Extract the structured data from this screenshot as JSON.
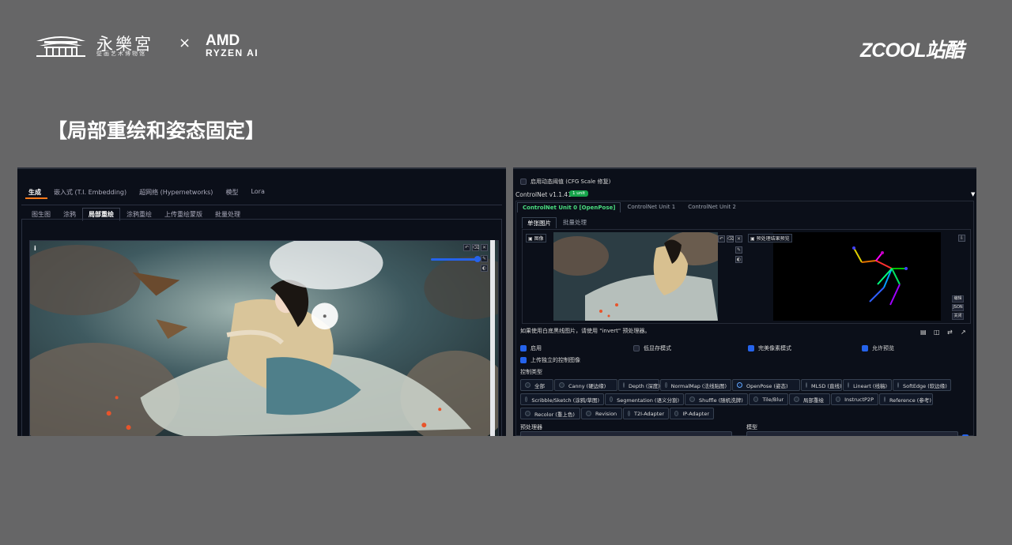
{
  "header": {
    "brand_cn": "永樂宮",
    "brand_sub": "壁画艺术博物馆",
    "times": "×",
    "amd": "AMD",
    "ryzen": "RYZEN AI",
    "zcool": "ZCOOL站酷"
  },
  "title": "【局部重绘和姿态固定】",
  "left": {
    "main_tabs": [
      "生成",
      "嵌入式 (T.I. Embedding)",
      "超网络 (Hypernetworks)",
      "模型",
      "Lora"
    ],
    "sub_tabs": [
      "图生图",
      "涂鸦",
      "局部重绘",
      "涂鸦重绘",
      "上传重绘蒙版",
      "批量处理"
    ],
    "active_sub_tab": "局部重绘",
    "info_icon": "i",
    "tool_icons": [
      "undo-icon",
      "clear-icon",
      "close-icon"
    ],
    "brush_icon": "brush-icon",
    "palette_icon": "palette-icon",
    "brush_size_fraction": 0.95
  },
  "right": {
    "cfg_label": "启用动态阈值 (CFG Scale 修复)",
    "controlnet_version": "ControlNet v1.1.410",
    "unit_badge": "1 unit",
    "unit_tabs": [
      "ControlNet Unit 0 [OpenPose]",
      "ControlNet Unit 1",
      "ControlNet Unit 2"
    ],
    "image_tabs": [
      "单张图片",
      "批量处理"
    ],
    "image_label": "图像",
    "preview_label": "预处理结果预览",
    "side_buttons": [
      "编辑",
      "JSON",
      "关闭"
    ],
    "invert_hint": "如果使用白底黑线图片，请使用 \"invert\" 预处理器。",
    "checkboxes": [
      {
        "label": "启用",
        "checked": true
      },
      {
        "label": "低显存模式",
        "checked": false
      },
      {
        "label": "完美像素模式",
        "checked": true
      },
      {
        "label": "允许预览",
        "checked": true
      }
    ],
    "upload_independent": {
      "label": "上传独立的控制图像",
      "checked": true
    },
    "control_type_label": "控制类型",
    "control_types_row1": [
      "全部",
      "Canny (硬边缘)",
      "Depth (深度)",
      "NormalMap (法线贴图)",
      "OpenPose (姿态)",
      "MLSD (直线)",
      "Lineart (线稿)",
      "SoftEdge (软边缘)"
    ],
    "control_types_row2": [
      "Scribble/Sketch (涂鸦/草图)",
      "Segmentation (语义分割)",
      "Shuffle (随机洗牌)",
      "Tile/Blur",
      "局部重绘",
      "InstructP2P",
      "Reference (参考)"
    ],
    "control_types_row3": [
      "Recolor (重上色)",
      "Revision",
      "T2I-Adapter",
      "IP-Adapter"
    ],
    "selected_control_type": "OpenPose (姿态)",
    "preprocessor_label": "预处理器",
    "model_label": "模型"
  },
  "colors": {
    "accent": "#2563eb",
    "badge": "#16a34a",
    "active_unit": "#4ade80",
    "panel_bg": "#0b0f19",
    "slide_bg": "#666667"
  }
}
